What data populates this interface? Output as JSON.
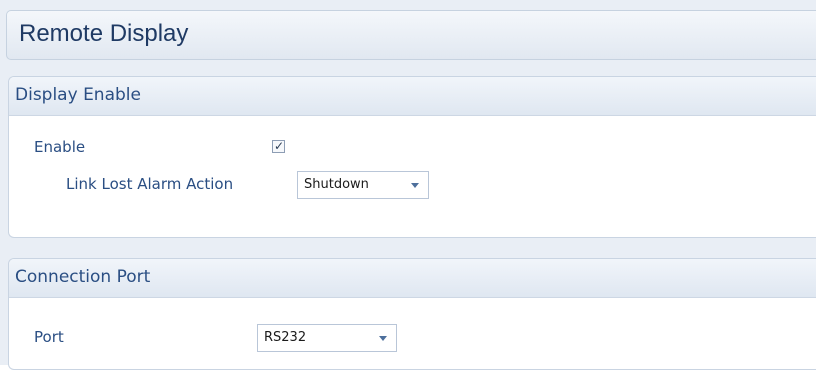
{
  "page": {
    "title": "Remote Display"
  },
  "display_enable": {
    "header": "Display Enable",
    "enable_label": "Enable",
    "enable_checked": true,
    "link_lost_label": "Link Lost Alarm Action",
    "link_lost_value": "Shutdown"
  },
  "connection_port": {
    "header": "Connection Port",
    "port_label": "Port",
    "port_value": "RS232"
  },
  "colors": {
    "title_text": "#1f3a64",
    "label_text": "#2a4e83",
    "header_gradient_top": "#f1f5fa",
    "header_gradient_bottom": "#dfe7f1",
    "border": "#c9d4e2"
  },
  "icons": {
    "checkbox_checked": "check-icon",
    "dropdown": "chevron-down-icon"
  }
}
